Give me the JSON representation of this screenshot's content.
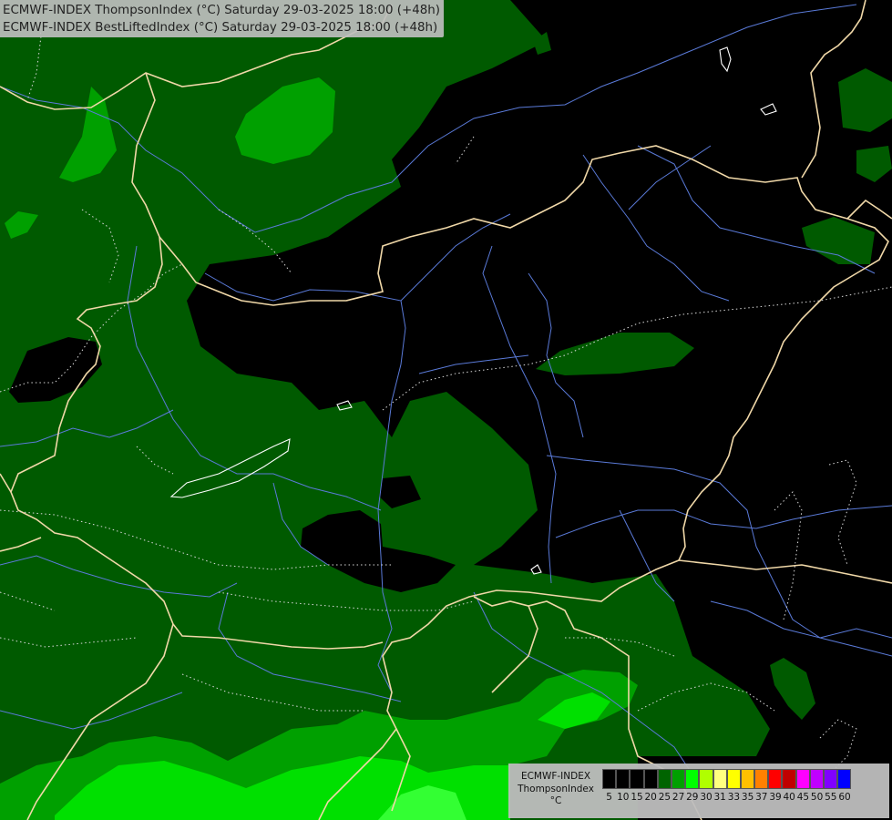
{
  "titles": {
    "line1": "ECMWF-INDEX ThompsonIndex (°C) Saturday 29-03-2025 18:00 (+48h)",
    "line2": "ECMWF-INDEX BestLiftedIndex (°C) Saturday 29-03-2025 18:00 (+48h)"
  },
  "legend": {
    "model": "ECMWF-INDEX",
    "parameter": "ThompsonIndex",
    "unit": "°C",
    "classes": [
      {
        "value": "5",
        "color": "#000000"
      },
      {
        "value": "10",
        "color": "#000000"
      },
      {
        "value": "15",
        "color": "#000000"
      },
      {
        "value": "20",
        "color": "#000000"
      },
      {
        "value": "25",
        "color": "#006400"
      },
      {
        "value": "27",
        "color": "#00a000"
      },
      {
        "value": "29",
        "color": "#00ff00"
      },
      {
        "value": "30",
        "color": "#b0ff00"
      },
      {
        "value": "31",
        "color": "#ffff80"
      },
      {
        "value": "33",
        "color": "#ffff00"
      },
      {
        "value": "35",
        "color": "#ffc000"
      },
      {
        "value": "37",
        "color": "#ff8000"
      },
      {
        "value": "39",
        "color": "#ff0000"
      },
      {
        "value": "40",
        "color": "#c00000"
      },
      {
        "value": "45",
        "color": "#ff00ff"
      },
      {
        "value": "50",
        "color": "#c000ff"
      },
      {
        "value": "55",
        "color": "#8000ff"
      },
      {
        "value": "60",
        "color": "#0000ff"
      }
    ]
  },
  "colors": {
    "background_black": "#000000",
    "dark_green": "#005a00",
    "mid_green": "#00a000",
    "bright_green": "#00dc00",
    "lime_green": "#22ff22",
    "borders": "#f0d8a8",
    "rivers": "#5a7ad8"
  }
}
